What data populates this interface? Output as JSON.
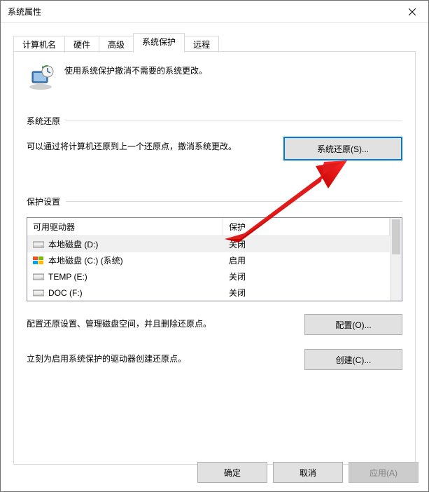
{
  "window": {
    "title": "系统属性"
  },
  "tabs": {
    "items": [
      {
        "label": "计算机名",
        "active": false
      },
      {
        "label": "硬件",
        "active": false
      },
      {
        "label": "高级",
        "active": false
      },
      {
        "label": "系统保护",
        "active": true
      },
      {
        "label": "远程",
        "active": false
      }
    ]
  },
  "intro": {
    "text": "使用系统保护撤消不需要的系统更改。"
  },
  "restore": {
    "heading": "系统还原",
    "desc": "可以通过将计算机还原到上一个还原点，撤消系统更改。",
    "button": "系统还原(S)..."
  },
  "protection": {
    "heading": "保护设置",
    "col_drive": "可用驱动器",
    "col_status": "保护",
    "drives": [
      {
        "name": "本地磁盘 (D:)",
        "status": "关闭",
        "icon": "hdd"
      },
      {
        "name": "本地磁盘 (C:) (系统)",
        "status": "启用",
        "icon": "win"
      },
      {
        "name": "TEMP (E:)",
        "status": "关闭",
        "icon": "hdd"
      },
      {
        "name": "DOC (F:)",
        "status": "关闭",
        "icon": "hdd"
      }
    ],
    "configure_desc": "配置还原设置、管理磁盘空间，并且删除还原点。",
    "configure_btn": "配置(O)...",
    "create_desc": "立刻为启用系统保护的驱动器创建还原点。",
    "create_btn": "创建(C)..."
  },
  "buttons": {
    "ok": "确定",
    "cancel": "取消",
    "apply": "应用(A)"
  }
}
